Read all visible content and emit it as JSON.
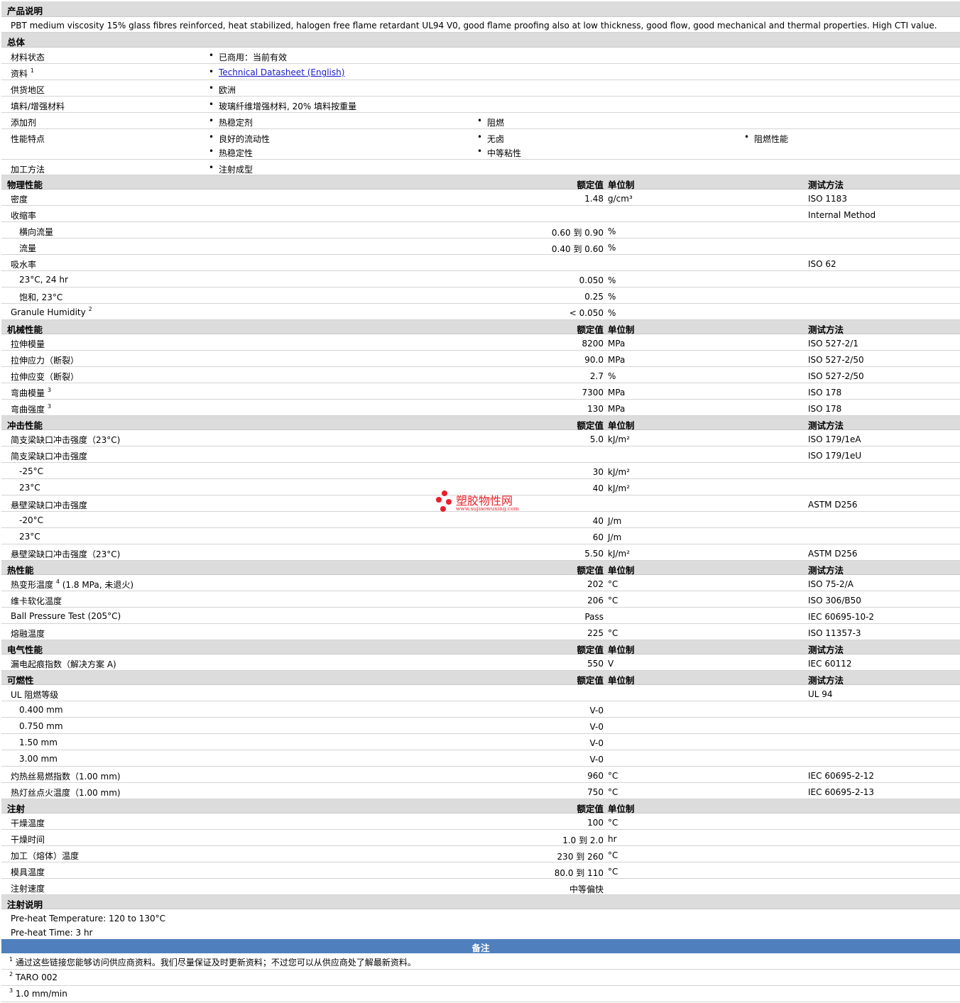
{
  "description": {
    "title": "产品说明",
    "text": "PBT medium viscosity 15% glass fibres reinforced, heat stabilized, halogen free flame retardant UL94 V0, good flame proofing also at low thickness, good flow, good mechanical and thermal properties. High CTI value."
  },
  "general": {
    "title": "总体",
    "rows": [
      {
        "label": "材料状态",
        "items": [
          "已商用：当前有效"
        ]
      },
      {
        "label": "资料",
        "sup": "1",
        "items": [
          "Technical Datasheet (English)"
        ]
      },
      {
        "label": "供货地区",
        "items": [
          "欧洲"
        ]
      },
      {
        "label": "填料/增强材料",
        "items": [
          "玻璃纤维增强材料, 20% 填料按重量"
        ]
      },
      {
        "label": "添加剂",
        "items": [
          "热稳定剂",
          "阻燃"
        ]
      },
      {
        "label": "性能特点",
        "items": [
          "良好的流动性",
          "无卤",
          "阻燃性能",
          "热稳定性",
          "中等粘性"
        ]
      },
      {
        "label": "加工方法",
        "items": [
          "注射成型"
        ]
      }
    ]
  },
  "headers": {
    "value": "额定值",
    "unit": "单位制",
    "test": "测试方法"
  },
  "sections": {
    "physical": "物理性能",
    "mechanical": "机械性能",
    "impact": "冲击性能",
    "thermal": "热性能",
    "electrical": "电气性能",
    "flammability": "可燃性",
    "injection": "注射",
    "injection_notes": "注射说明",
    "notes": "备注"
  },
  "rows": [
    {
      "label": "密度",
      "value": "1.48",
      "unit": "g/cm³",
      "test": "ISO 1183"
    },
    {
      "label": "收缩率",
      "value": "",
      "unit": "",
      "test": "Internal Method"
    },
    {
      "label": "横向流量",
      "value": "0.60 到  0.90",
      "unit": "%",
      "test": ""
    },
    {
      "label": "流量",
      "value": "0.40 到  0.60",
      "unit": "%",
      "test": ""
    },
    {
      "label": "吸水率",
      "value": "",
      "unit": "",
      "test": "ISO 62"
    },
    {
      "label": "23°C, 24 hr",
      "value": "0.050",
      "unit": "%",
      "test": ""
    },
    {
      "label": "饱和, 23°C",
      "value": "0.25",
      "unit": "%",
      "test": ""
    },
    {
      "label": "Granule Humidity",
      "sup": "2",
      "value": "< 0.050",
      "unit": "%",
      "test": ""
    },
    {
      "label": "拉伸模量",
      "value": "8200",
      "unit": "MPa",
      "test": "ISO 527-2/1"
    },
    {
      "label": "拉伸应力（断裂）",
      "value": "90.0",
      "unit": "MPa",
      "test": "ISO 527-2/50"
    },
    {
      "label": "拉伸应变（断裂）",
      "value": "2.7",
      "unit": "%",
      "test": "ISO 527-2/50"
    },
    {
      "label": "弯曲模量",
      "sup": "3",
      "value": "7300",
      "unit": "MPa",
      "test": "ISO 178"
    },
    {
      "label": "弯曲强度",
      "sup": "3",
      "value": "130",
      "unit": "MPa",
      "test": "ISO 178"
    },
    {
      "label": "简支梁缺口冲击强度（23°C)",
      "value": "5.0",
      "unit": "kJ/m²",
      "test": "ISO 179/1eA"
    },
    {
      "label": "简支梁缺口冲击强度",
      "value": "",
      "unit": "",
      "test": "ISO 179/1eU"
    },
    {
      "label": "-25°C",
      "value": "30",
      "unit": "kJ/m²",
      "test": ""
    },
    {
      "label": "23°C",
      "value": "40",
      "unit": "kJ/m²",
      "test": ""
    },
    {
      "label": "悬壁梁缺口冲击强度",
      "value": "",
      "unit": "",
      "test": "ASTM D256"
    },
    {
      "label": "-20°C",
      "value": "40",
      "unit": "J/m",
      "test": ""
    },
    {
      "label": "23°C",
      "value": "60",
      "unit": "J/m",
      "test": ""
    },
    {
      "label": "悬壁梁缺口冲击强度（23°C)",
      "value": "5.50",
      "unit": "kJ/m²",
      "test": "ASTM D256"
    },
    {
      "label": "热变形温度",
      "sup": "4",
      "label2": " (1.8 MPa, 未退火)",
      "value": "202",
      "unit": "°C",
      "test": "ISO 75-2/A"
    },
    {
      "label": "维卡软化温度",
      "value": "206",
      "unit": "°C",
      "test": "ISO 306/B50"
    },
    {
      "label": "Ball Pressure Test (205°C)",
      "value": "Pass",
      "unit": "",
      "test": "IEC 60695-10-2"
    },
    {
      "label": "熔融温度",
      "value": "225",
      "unit": "°C",
      "test": "ISO 11357-3"
    },
    {
      "label": "漏电起痕指数（解决方案  A)",
      "value": "550",
      "unit": "V",
      "test": "IEC 60112"
    },
    {
      "label": "UL 阻燃等级",
      "value": "",
      "unit": "",
      "test": "UL 94"
    },
    {
      "label": "0.400 mm",
      "value": "V-0",
      "unit": "",
      "test": ""
    },
    {
      "label": "0.750 mm",
      "value": "V-0",
      "unit": "",
      "test": ""
    },
    {
      "label": "1.50 mm",
      "value": "V-0",
      "unit": "",
      "test": ""
    },
    {
      "label": "3.00 mm",
      "value": "V-0",
      "unit": "",
      "test": ""
    },
    {
      "label": "灼热丝易燃指数（1.00 mm)",
      "value": "960",
      "unit": "°C",
      "test": "IEC 60695-2-12"
    },
    {
      "label": "热灯丝点火温度（1.00 mm)",
      "value": "750",
      "unit": "°C",
      "test": "IEC 60695-2-13"
    },
    {
      "label": "干燥温度",
      "value": "100",
      "unit": "°C",
      "test": ""
    },
    {
      "label": "干燥时间",
      "value": "1.0 到  2.0",
      "unit": "hr",
      "test": ""
    },
    {
      "label": "加工（熔体）温度",
      "value": "230 到  260",
      "unit": "°C",
      "test": ""
    },
    {
      "label": "模具温度",
      "value": "80.0 到  110",
      "unit": "°C",
      "test": ""
    },
    {
      "label": "注射速度",
      "value": "中等偏快",
      "unit": "",
      "test": ""
    }
  ],
  "injection_notes": [
    "Pre-heat Temperature: 120 to 130°C",
    "Pre-heat Time: 3 hr"
  ],
  "footnotes": [
    {
      "n": "1",
      "text": "通过这些链接您能够访问供应商资料。我们尽量保证及时更新资料；不过您可以从供应商处了解最新资料。"
    },
    {
      "n": "2",
      "text": "TARO 002"
    },
    {
      "n": "3",
      "text": "1.0 mm/min"
    }
  ],
  "watermark": {
    "name": "塑胶物性网",
    "url": "www.sujiaowuxing.com",
    "color": "#e8202a"
  }
}
